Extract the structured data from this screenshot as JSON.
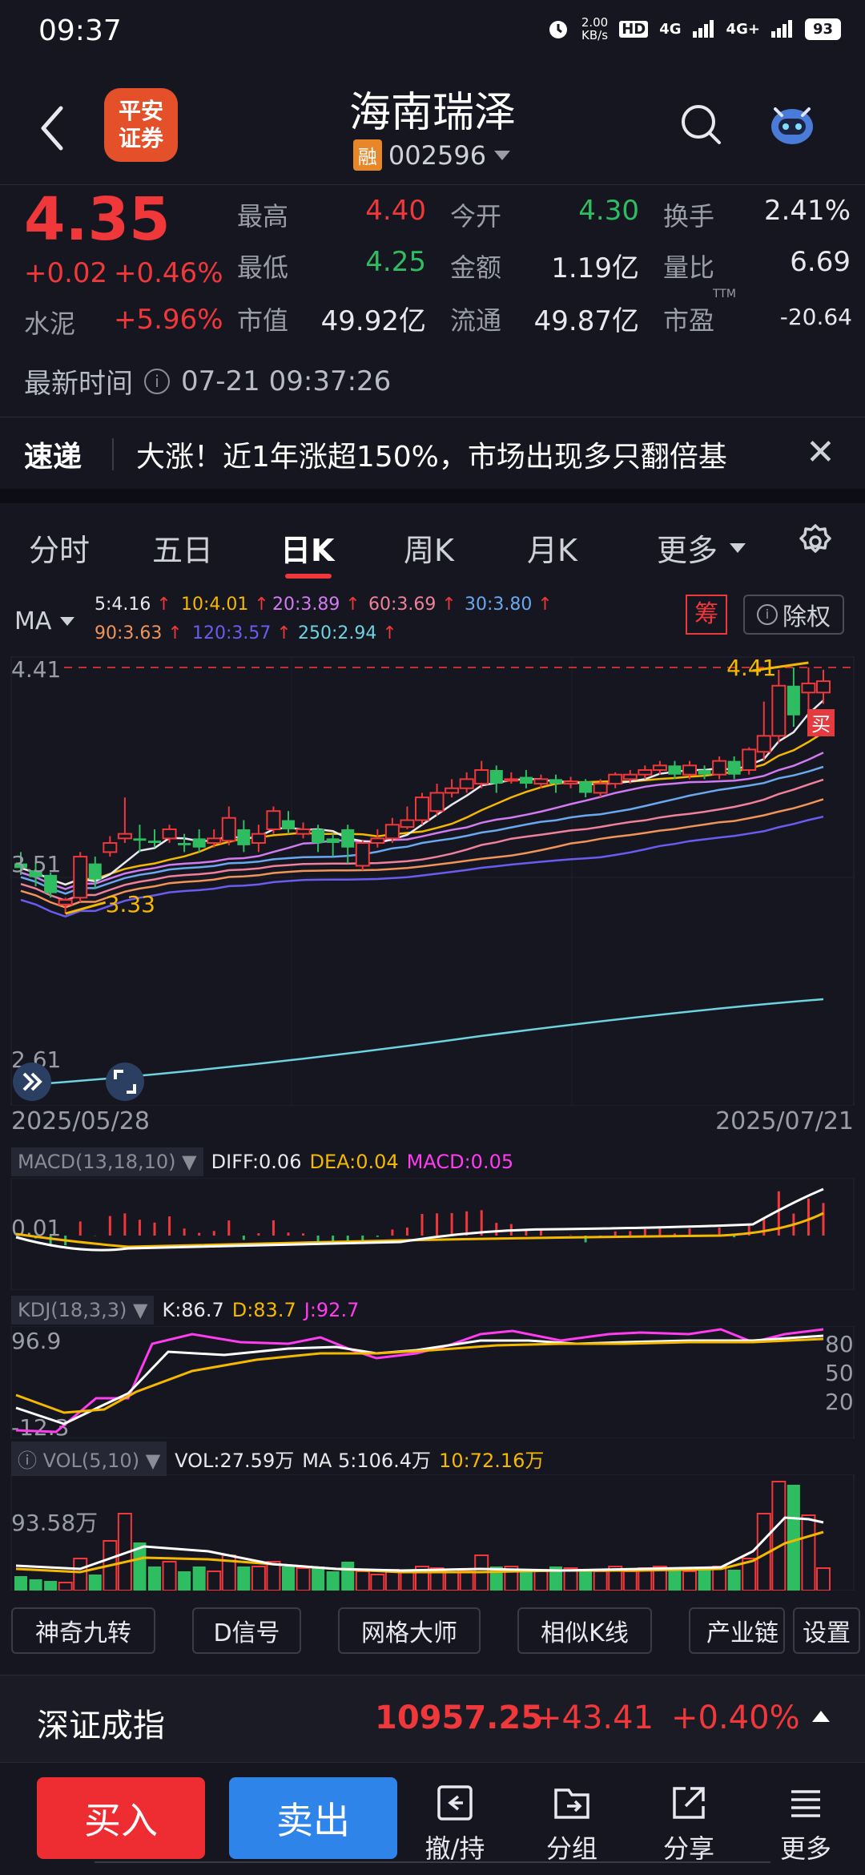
{
  "status": {
    "time": "09:37",
    "net_speed": "2.00",
    "net_unit": "KB/s",
    "hd": "HD",
    "sig1": "4G",
    "sig2": "4G+",
    "battery": "93"
  },
  "header": {
    "logo_line1": "平安",
    "logo_line2": "证券",
    "title": "海南瑞泽",
    "badge": "融",
    "code": "002596"
  },
  "quote": {
    "price": "4.35",
    "change": "+0.02",
    "change_pct": "+0.46%",
    "sector": "水泥",
    "sector_pct": "+5.96%",
    "high_label": "最高",
    "high": "4.40",
    "open_label": "今开",
    "open": "4.30",
    "turnover_label": "换手",
    "turnover": "2.41%",
    "low_label": "最低",
    "low": "4.25",
    "amount_label": "金额",
    "amount": "1.19亿",
    "vol_ratio_label": "量比",
    "vol_ratio": "6.69",
    "mcap_label": "市值",
    "mcap": "49.92亿",
    "float_label": "流通",
    "float": "49.87亿",
    "pe_label": "市盈",
    "pe_sup": "TTM",
    "pe": "-20.64",
    "update_label": "最新时间",
    "update_time": "07-21 09:37:26"
  },
  "news": {
    "tag": "速递",
    "text": "大涨！近1年涨超150%，市场出现多只翻倍基"
  },
  "tabs": [
    "分时",
    "五日",
    "日K",
    "周K",
    "月K",
    "更多"
  ],
  "ma": {
    "dropdown": "MA",
    "items": [
      {
        "label": "5:4.16",
        "color": "#e8e9ee"
      },
      {
        "label": "10:4.01",
        "color": "#f5b800"
      },
      {
        "label": "20:3.89",
        "color": "#d07bf0"
      },
      {
        "label": "60:3.69",
        "color": "#f0819a"
      },
      {
        "label": "30:3.80",
        "color": "#6aa8f0"
      },
      {
        "label": "90:3.63",
        "color": "#f0945a"
      },
      {
        "label": "120:3.57",
        "color": "#6a5cf0"
      },
      {
        "label": "250:2.94",
        "color": "#6ed3e0"
      }
    ],
    "arrow": "↑",
    "chou": "筹",
    "chuquan": "除权"
  },
  "chart_labels": {
    "y_top": "4.41",
    "y_mid": "3.51",
    "y_bottom": "2.61",
    "max_label": "4.41",
    "min_label": "3.33",
    "buy_tag": "买"
  },
  "dates": {
    "start": "2025/05/28",
    "end": "2025/07/21"
  },
  "macd": {
    "name": "MACD(13,18,10)",
    "diff": "DIFF:0.06",
    "dea": "DEA:0.04",
    "macd": "MACD:0.05",
    "axis": "0.01"
  },
  "kdj": {
    "name": "KDJ(18,3,3)",
    "k": "K:86.7",
    "d": "D:83.7",
    "j": "J:92.7",
    "y_top": "96.9",
    "y_bottom": "-12.3",
    "r80": "80",
    "r50": "50",
    "r20": "20"
  },
  "vol": {
    "name": "VOL(5,10)",
    "vol": "VOL:27.59万",
    "ma5": "MA 5:106.4万",
    "ma10": "10:72.16万",
    "axis": "93.58万"
  },
  "tools": [
    "神奇九转",
    "D信号",
    "网格大师",
    "相似K线",
    "产业链",
    "设置"
  ],
  "index": {
    "name": "深证成指",
    "value": "10957.25",
    "change": "+43.41",
    "pct": "+0.40%"
  },
  "bottom": {
    "buy": "买入",
    "sell": "卖出",
    "nav": [
      "撤/持",
      "分组",
      "分享",
      "更多"
    ]
  },
  "chart_data": {
    "type": "candlestick",
    "date_range": [
      "2025/05/28",
      "2025/07/21"
    ],
    "ylim": [
      2.61,
      4.41
    ],
    "ma_legend": {
      "MA5": 4.16,
      "MA10": 4.01,
      "MA20": 3.89,
      "MA30": 3.8,
      "MA60": 3.69,
      "MA90": 3.63,
      "MA120": 3.57,
      "MA250": 2.94
    },
    "high_annotation": 4.41,
    "low_annotation": 3.33,
    "candles": [
      [
        3.55,
        3.53,
        3.6,
        3.5
      ],
      [
        3.52,
        3.49,
        3.56,
        3.45
      ],
      [
        3.5,
        3.42,
        3.51,
        3.4
      ],
      [
        3.37,
        3.39,
        3.4,
        3.33
      ],
      [
        3.4,
        3.58,
        3.6,
        3.38
      ],
      [
        3.55,
        3.48,
        3.58,
        3.44
      ],
      [
        3.6,
        3.64,
        3.67,
        3.58
      ],
      [
        3.66,
        3.68,
        3.84,
        3.64
      ],
      [
        3.66,
        3.65,
        3.72,
        3.6
      ],
      [
        3.65,
        3.64,
        3.7,
        3.62
      ],
      [
        3.66,
        3.7,
        3.72,
        3.64
      ],
      [
        3.64,
        3.63,
        3.68,
        3.6
      ],
      [
        3.66,
        3.62,
        3.7,
        3.6
      ],
      [
        3.64,
        3.66,
        3.7,
        3.62
      ],
      [
        3.65,
        3.75,
        3.8,
        3.63
      ],
      [
        3.7,
        3.63,
        3.74,
        3.6
      ],
      [
        3.64,
        3.68,
        3.72,
        3.6
      ],
      [
        3.7,
        3.78,
        3.8,
        3.68
      ],
      [
        3.74,
        3.7,
        3.78,
        3.68
      ],
      [
        3.68,
        3.7,
        3.73,
        3.66
      ],
      [
        3.7,
        3.64,
        3.72,
        3.6
      ],
      [
        3.66,
        3.64,
        3.68,
        3.58
      ],
      [
        3.7,
        3.62,
        3.72,
        3.55
      ],
      [
        3.54,
        3.64,
        3.65,
        3.52
      ],
      [
        3.64,
        3.66,
        3.7,
        3.62
      ],
      [
        3.66,
        3.72,
        3.75,
        3.64
      ],
      [
        3.71,
        3.74,
        3.8,
        3.7
      ],
      [
        3.74,
        3.84,
        3.86,
        3.72
      ],
      [
        3.78,
        3.86,
        3.9,
        3.76
      ],
      [
        3.86,
        3.88,
        3.92,
        3.84
      ],
      [
        3.88,
        3.92,
        3.95,
        3.86
      ],
      [
        3.9,
        3.96,
        4.0,
        3.88
      ],
      [
        3.96,
        3.9,
        3.98,
        3.86
      ],
      [
        3.92,
        3.92,
        3.95,
        3.9
      ],
      [
        3.93,
        3.9,
        3.96,
        3.88
      ],
      [
        3.9,
        3.92,
        3.94,
        3.88
      ],
      [
        3.92,
        3.9,
        3.94,
        3.86
      ],
      [
        3.9,
        3.91,
        3.93,
        3.88
      ],
      [
        3.91,
        3.86,
        3.92,
        3.84
      ],
      [
        3.86,
        3.9,
        3.92,
        3.84
      ],
      [
        3.9,
        3.94,
        3.95,
        3.88
      ],
      [
        3.92,
        3.94,
        3.96,
        3.9
      ],
      [
        3.94,
        3.96,
        3.98,
        3.92
      ],
      [
        3.96,
        3.98,
        4.0,
        3.94
      ],
      [
        3.98,
        3.94,
        4.0,
        3.92
      ],
      [
        3.94,
        3.98,
        4.0,
        3.92
      ],
      [
        3.96,
        3.94,
        3.98,
        3.92
      ],
      [
        3.94,
        4.0,
        4.02,
        3.92
      ],
      [
        4.0,
        3.94,
        4.02,
        3.92
      ],
      [
        3.96,
        4.05,
        4.06,
        3.94
      ],
      [
        4.04,
        4.11,
        4.26,
        4.0
      ],
      [
        4.11,
        4.33,
        4.4,
        4.08
      ],
      [
        4.33,
        4.2,
        4.41,
        4.15
      ],
      [
        4.3,
        4.34,
        4.41,
        4.18
      ],
      [
        4.3,
        4.35,
        4.4,
        4.25
      ]
    ]
  }
}
